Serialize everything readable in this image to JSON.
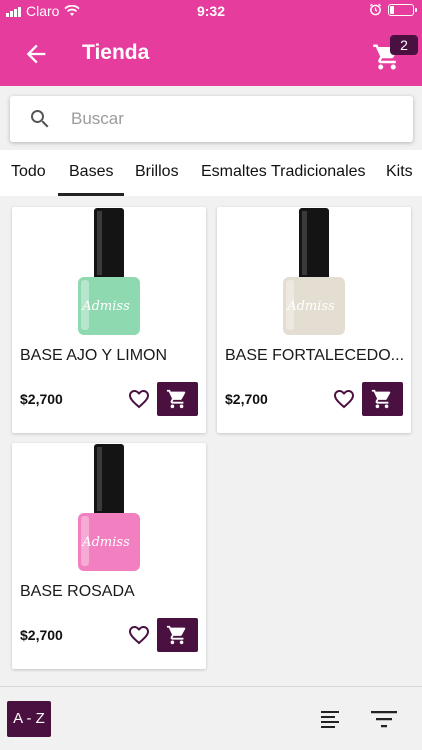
{
  "status": {
    "carrier": "Claro",
    "time": "9:32",
    "battery_level": 0.2
  },
  "header": {
    "title": "Tienda",
    "cart_count": "2"
  },
  "search": {
    "placeholder": "Buscar"
  },
  "tabs": [
    {
      "label": "Todo",
      "selected": false
    },
    {
      "label": "Bases",
      "selected": true
    },
    {
      "label": "Brillos",
      "selected": false
    },
    {
      "label": "Esmaltes Tradicionales",
      "selected": false
    },
    {
      "label": "Kits",
      "selected": false
    }
  ],
  "products": [
    {
      "name": "BASE AJO Y LIMON",
      "price": "$2,700",
      "bottle_color": "#8fd9b0",
      "bottle_text": "Admiss"
    },
    {
      "name": "BASE FORTALECEDO...",
      "price": "$2,700",
      "bottle_color": "#e4ded2",
      "bottle_text": "Admiss"
    },
    {
      "name": "BASE ROSADA",
      "price": "$2,700",
      "bottle_color": "#f27fbf",
      "bottle_text": "Admiss"
    }
  ],
  "bottom": {
    "az_label": "A - Z"
  },
  "colors": {
    "primary": "#e63c9e",
    "accent": "#4a1140"
  },
  "icons": [
    "back-arrow-icon",
    "cart-icon",
    "search-icon",
    "heart-icon",
    "add-to-cart-icon",
    "sort-icon",
    "filter-icon",
    "wifi-icon",
    "alarm-icon",
    "battery-icon",
    "signal-icon"
  ]
}
